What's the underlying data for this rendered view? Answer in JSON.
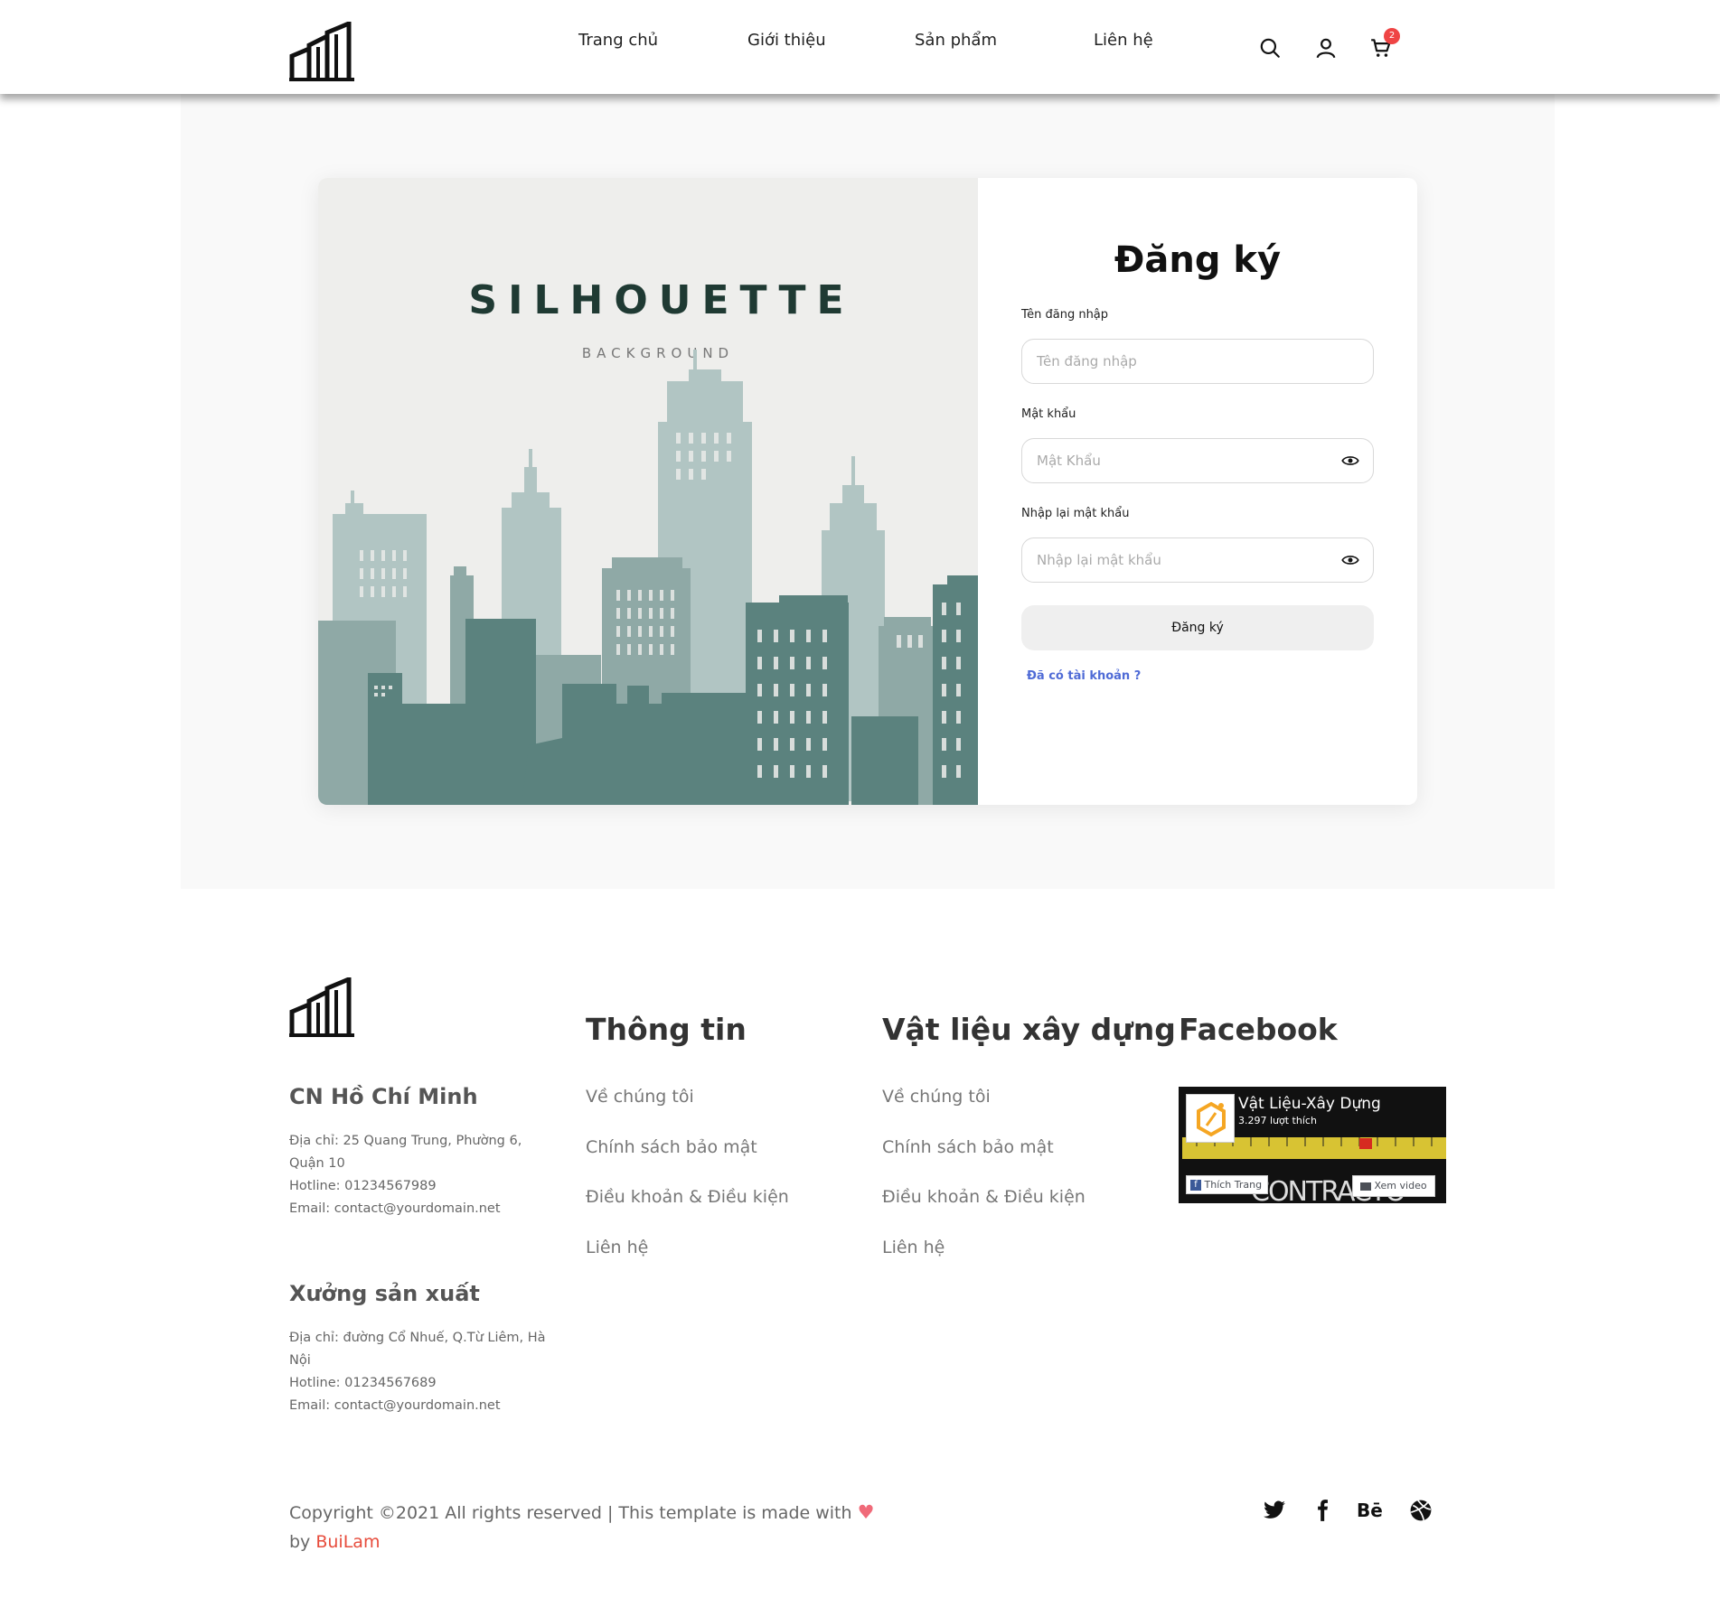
{
  "header": {
    "nav": [
      "Trang chủ",
      "Giới thiệu",
      "Sản phẩm",
      "Liên hệ"
    ],
    "cart_count": "2"
  },
  "illustration": {
    "title": "SILHOUETTE",
    "subtitle": "BACKGROUND"
  },
  "form": {
    "title": "Đăng ký",
    "username_label": "Tên đăng nhập",
    "username_placeholder": "Tên đăng nhập",
    "password_label": "Mật khẩu",
    "password_placeholder": "Mật Khẩu",
    "confirm_label": "Nhập lại mật khẩu",
    "confirm_placeholder": "Nhập lại mật khẩu",
    "submit_label": "Đăng ký",
    "login_link": "Đã có tài khoản ?"
  },
  "footer": {
    "branch1": {
      "title": "CN Hồ Chí Minh",
      "address_line1": "Địa chỉ: 25 Quang Trung, Phường 6,",
      "address_line2": "Quận 10",
      "hotline": "Hotline: 01234567989",
      "email": "Email: contact@yourdomain.net"
    },
    "branch2": {
      "title": "Xưởng sản xuất",
      "address_line1": "Địa chỉ: đường Cổ Nhuế, Q.Từ Liêm, Hà",
      "address_line2": "Nội",
      "hotline": "Hotline: 01234567689",
      "email": "Email: contact@yourdomain.net"
    },
    "col1": {
      "title": "Thông tin",
      "links": [
        "Về chúng tôi",
        "Chính sách bảo mật",
        "Điều khoản & Điều kiện",
        "Liên hệ"
      ]
    },
    "col2": {
      "title": "Vật liệu xây dựng",
      "links": [
        "Về chúng tôi",
        "Chính sách bảo mật",
        "Điều khoản & Điều kiện",
        "Liên hệ"
      ]
    },
    "col3": {
      "title": "Facebook"
    },
    "facebook": {
      "page_name": "Vật Liệu-Xây Dựng",
      "likes": "3.297 lượt thích",
      "like_button": "Thích Trang",
      "video_button": "Xem video",
      "bg_text": "CONTRACTO"
    },
    "copyright_text": "Copyright ©2021 All rights reserved | This template is made with",
    "by_text": "by",
    "author": "BuiLam"
  },
  "colors": {
    "accent_link": "#4f6bd6",
    "heart": "#f06a79",
    "author": "#e74c3c",
    "badge": "#ef4444",
    "building_dark": "#5b827e",
    "building_mid": "#8fa9a6",
    "building_light": "#b1c5c3"
  },
  "icons": [
    "search-icon",
    "user-icon",
    "cart-icon",
    "eye-icon",
    "twitter-icon",
    "facebook-icon",
    "behance-icon",
    "dribbble-icon",
    "heart-icon"
  ]
}
